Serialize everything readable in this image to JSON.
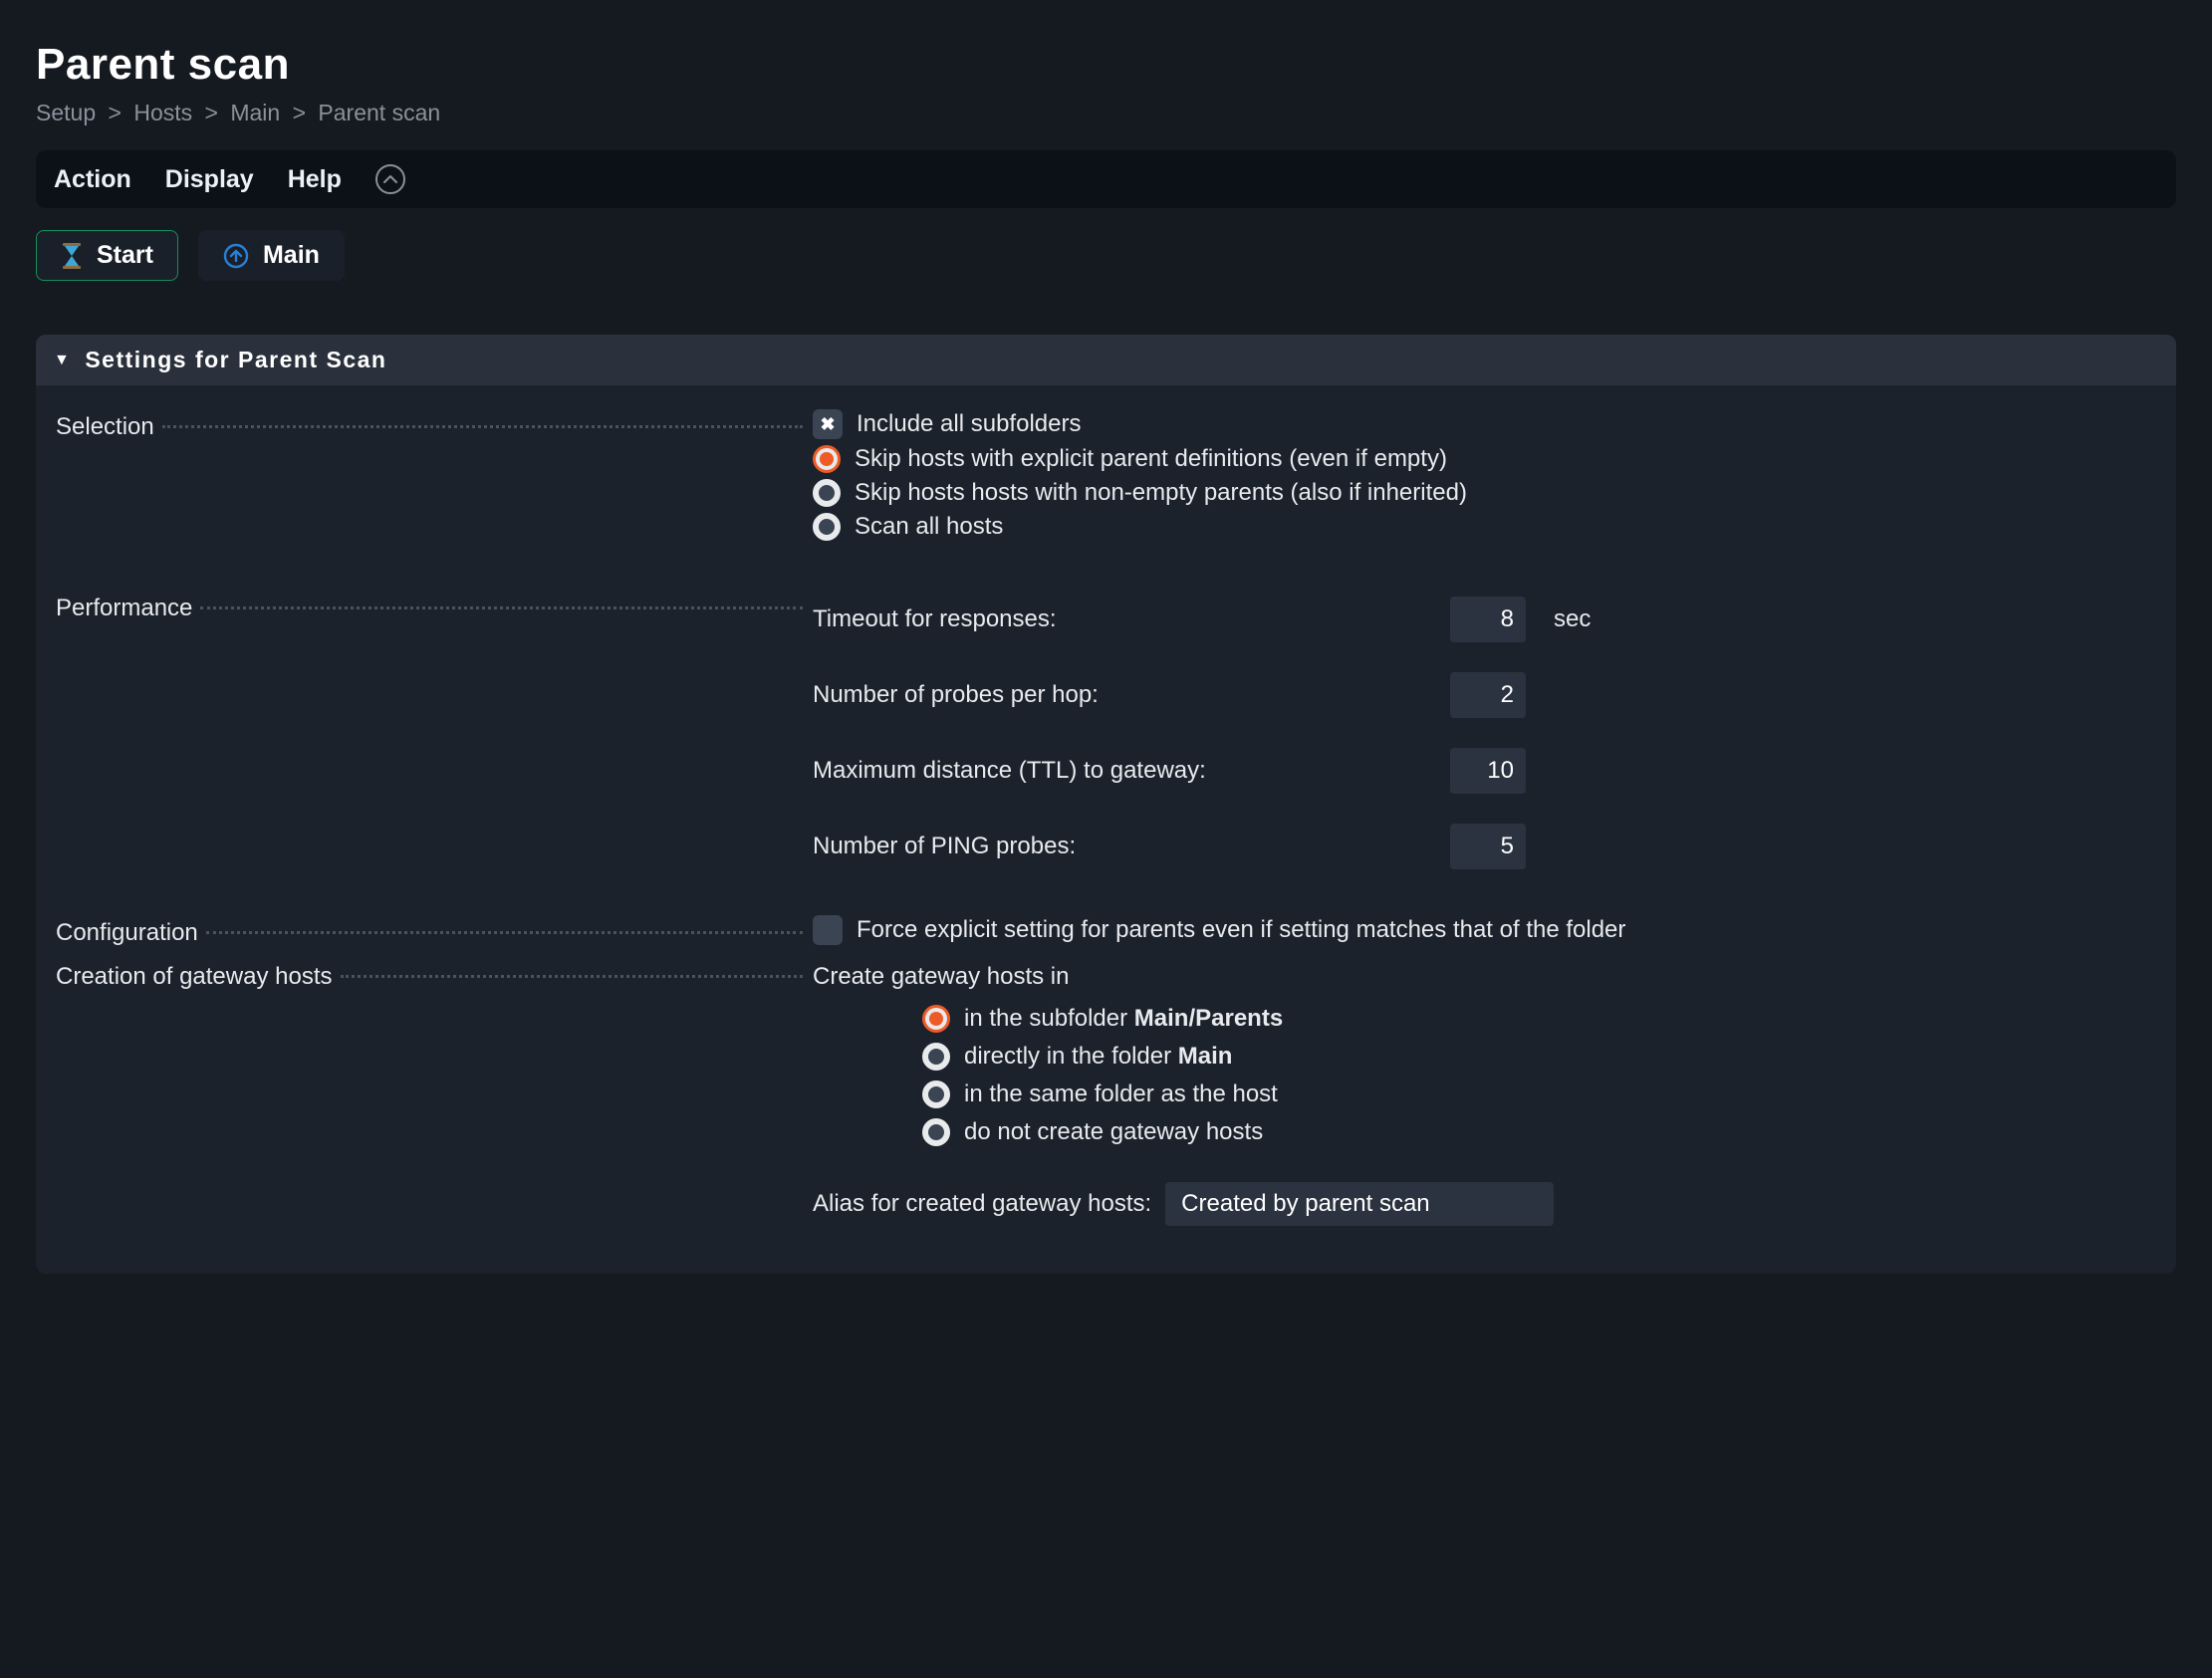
{
  "header": {
    "title": "Parent scan",
    "breadcrumb": [
      "Setup",
      "Hosts",
      "Main",
      "Parent scan"
    ]
  },
  "menubar": {
    "items": [
      "Action",
      "Display",
      "Help"
    ]
  },
  "buttons": {
    "start": "Start",
    "main": "Main"
  },
  "section": {
    "title": "Settings for Parent Scan"
  },
  "selection": {
    "label": "Selection",
    "include_subfolders": {
      "label": "Include all subfolders",
      "checked": true
    },
    "options": [
      {
        "label": "Skip hosts with explicit parent definitions (even if empty)",
        "selected": true
      },
      {
        "label": "Skip hosts hosts with non-empty parents (also if inherited)",
        "selected": false
      },
      {
        "label": "Scan all hosts",
        "selected": false
      }
    ]
  },
  "performance": {
    "label": "Performance",
    "rows": [
      {
        "label": "Timeout for responses:",
        "value": "8",
        "unit": "sec"
      },
      {
        "label": "Number of probes per hop:",
        "value": "2",
        "unit": ""
      },
      {
        "label": "Maximum distance (TTL) to gateway:",
        "value": "10",
        "unit": ""
      },
      {
        "label": "Number of PING probes:",
        "value": "5",
        "unit": ""
      }
    ]
  },
  "configuration": {
    "label": "Configuration",
    "force_explicit": {
      "label": "Force explicit setting for parents even if setting matches that of the folder",
      "checked": false
    }
  },
  "gateway": {
    "label": "Creation of gateway hosts",
    "create_in_label": "Create gateway hosts in",
    "options": [
      {
        "prefix": "in the subfolder ",
        "bold": "Main/Parents",
        "selected": true
      },
      {
        "prefix": "directly in the folder ",
        "bold": "Main",
        "selected": false
      },
      {
        "prefix": "in the same folder as the host",
        "bold": "",
        "selected": false
      },
      {
        "prefix": "do not create gateway hosts",
        "bold": "",
        "selected": false
      }
    ],
    "alias_label": "Alias for created gateway hosts:",
    "alias_value": "Created by parent scan"
  }
}
